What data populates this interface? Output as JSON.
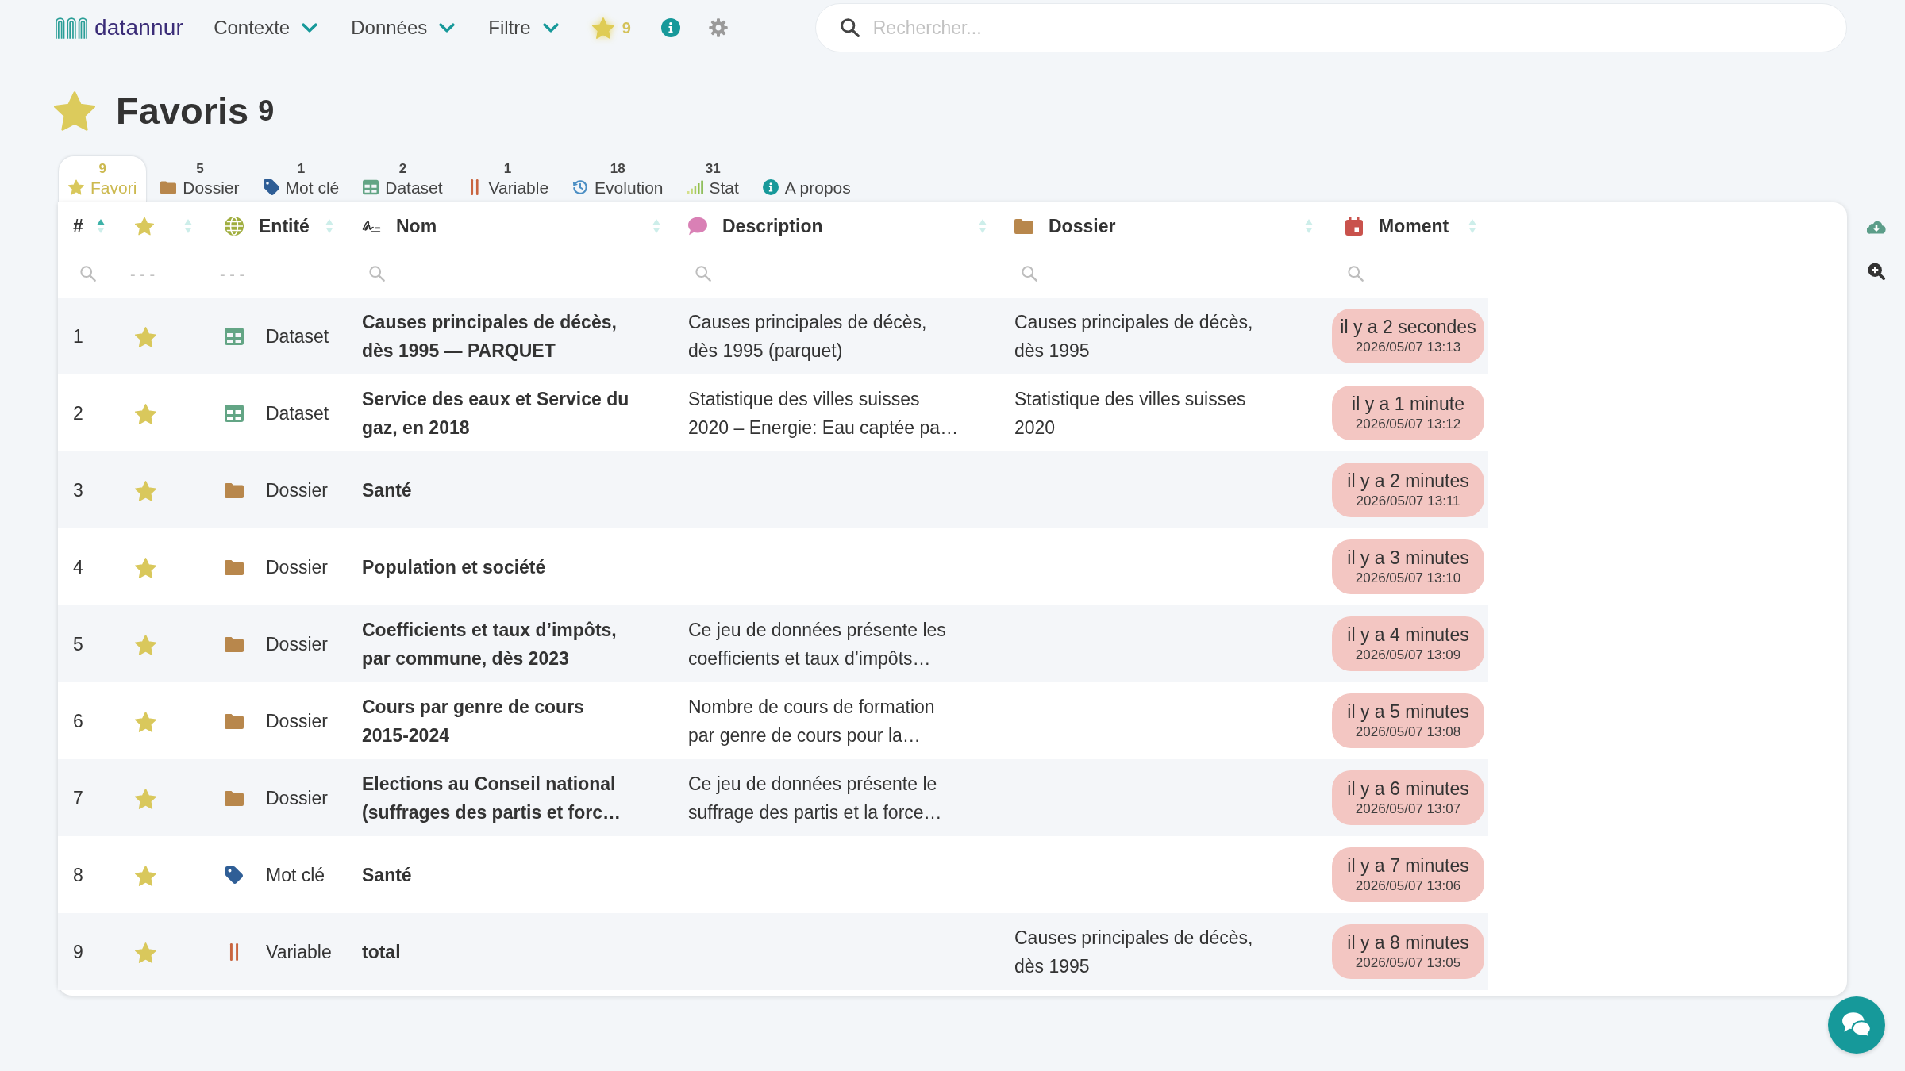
{
  "navbar": {
    "logo": "datannur",
    "menus": [
      {
        "label": "Contexte"
      },
      {
        "label": "Données"
      },
      {
        "label": "Filtre"
      }
    ],
    "favorites": {
      "count": "9"
    },
    "search": {
      "placeholder": "Rechercher..."
    }
  },
  "page": {
    "title": "Favoris",
    "count": "9"
  },
  "tabs": [
    {
      "kind": "favorite",
      "count": "9",
      "label": "Favori",
      "selected": true
    },
    {
      "kind": "folder",
      "count": "5",
      "label": "Dossier",
      "selected": false
    },
    {
      "kind": "tag",
      "count": "1",
      "label": "Mot clé",
      "selected": false
    },
    {
      "kind": "dataset",
      "count": "2",
      "label": "Dataset",
      "selected": false
    },
    {
      "kind": "variable",
      "count": "1",
      "label": "Variable",
      "selected": false
    },
    {
      "kind": "evolution",
      "count": "18",
      "label": "Evolution",
      "selected": false
    },
    {
      "kind": "stat",
      "count": "31",
      "label": "Stat",
      "selected": false
    },
    {
      "kind": "about",
      "label": "A propos",
      "selected": false
    }
  ],
  "table": {
    "columns": [
      {
        "kind": "number",
        "label": "#",
        "sorted": true,
        "filter": {
          "kind": "search"
        }
      },
      {
        "kind": "favorite",
        "sorted": false,
        "filter": {
          "kind": "select",
          "placeholder": "- - -"
        }
      },
      {
        "kind": "entity",
        "label": "Entité",
        "sorted": false,
        "filter": {
          "kind": "select",
          "placeholder": "- - -"
        }
      },
      {
        "kind": "name",
        "label": "Nom",
        "sorted": false,
        "filter": {
          "kind": "search"
        }
      },
      {
        "kind": "description",
        "label": "Description",
        "sorted": false,
        "filter": {
          "kind": "search"
        }
      },
      {
        "kind": "folder",
        "label": "Dossier",
        "sorted": false,
        "filter": {
          "kind": "search"
        }
      },
      {
        "kind": "moment",
        "label": "Moment",
        "sorted": false,
        "filter": {
          "kind": "search"
        }
      }
    ],
    "rows": [
      {
        "number": "1",
        "favorite": true,
        "entity": {
          "kind": "dataset",
          "label": "Dataset"
        },
        "name": "Causes principales de décès, dès 1995 — PARQUET",
        "description": "Causes principales de décès, dès 1995 (parquet)",
        "folder": "Causes principales de décès, dès 1995",
        "moment": {
          "relative": "il y a 2 secondes",
          "date": "2026/05/07 13:13"
        }
      },
      {
        "number": "2",
        "favorite": true,
        "entity": {
          "kind": "dataset",
          "label": "Dataset"
        },
        "name": "Service des eaux et Service du gaz, en 2018",
        "description": "Statistique des villes suisses 2020 – Energie: Eau captée pa…",
        "folder": "Statistique des villes suisses 2020",
        "moment": {
          "relative": "il y a 1 minute",
          "date": "2026/05/07 13:12"
        }
      },
      {
        "number": "3",
        "favorite": true,
        "entity": {
          "kind": "folder",
          "label": "Dossier"
        },
        "name": "Santé",
        "moment": {
          "relative": "il y a 2 minutes",
          "date": "2026/05/07 13:11"
        }
      },
      {
        "number": "4",
        "favorite": true,
        "entity": {
          "kind": "folder",
          "label": "Dossier"
        },
        "name": "Population et société",
        "moment": {
          "relative": "il y a 3 minutes",
          "date": "2026/05/07 13:10"
        }
      },
      {
        "number": "5",
        "favorite": true,
        "entity": {
          "kind": "folder",
          "label": "Dossier"
        },
        "name": "Coefficients et taux d’impôts, par commune, dès 2023",
        "description": "Ce jeu de données présente les coefficients et taux d’impôts…",
        "moment": {
          "relative": "il y a 4 minutes",
          "date": "2026/05/07 13:09"
        }
      },
      {
        "number": "6",
        "favorite": true,
        "entity": {
          "kind": "folder",
          "label": "Dossier"
        },
        "name": "Cours par genre de cours 2015-2024",
        "description": "Nombre de cours de formation par genre de cours pour la…",
        "moment": {
          "relative": "il y a 5 minutes",
          "date": "2026/05/07 13:08"
        }
      },
      {
        "number": "7",
        "favorite": true,
        "entity": {
          "kind": "folder",
          "label": "Dossier"
        },
        "name": "Elections au Conseil national (suffrages des partis et forc…",
        "description": "Ce jeu de données présente le suffrage des partis et la force…",
        "moment": {
          "relative": "il y a 6 minutes",
          "date": "2026/05/07 13:07"
        }
      },
      {
        "number": "8",
        "favorite": true,
        "entity": {
          "kind": "tag",
          "label": "Mot clé"
        },
        "name": "Santé",
        "moment": {
          "relative": "il y a 7 minutes",
          "date": "2026/05/07 13:06"
        }
      },
      {
        "number": "9",
        "favorite": true,
        "entity": {
          "kind": "variable",
          "label": "Variable"
        },
        "name": "total",
        "folder": "Causes principales de décès, dès 1995",
        "moment": {
          "relative": "il y a 8 minutes",
          "date": "2026/05/07 13:05"
        }
      }
    ]
  }
}
